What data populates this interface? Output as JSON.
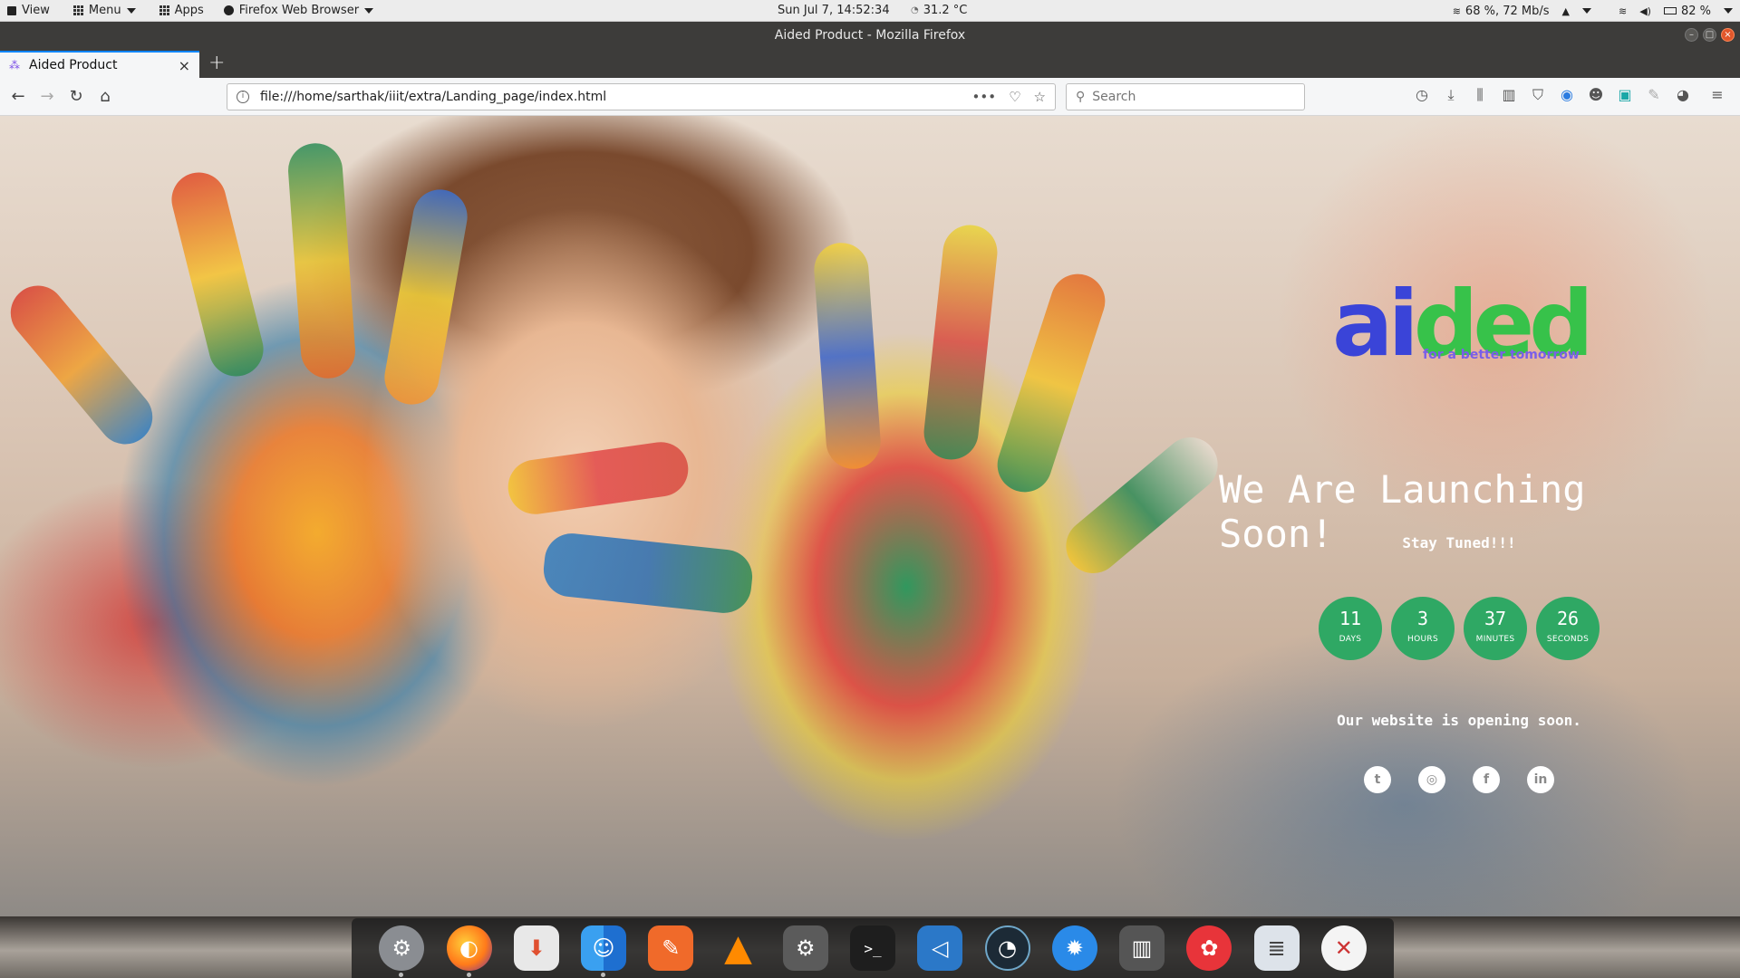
{
  "top_panel": {
    "view_label": "View",
    "menu_label": "Menu",
    "apps_label": "Apps",
    "browser_label": "Firefox Web Browser",
    "clock": "Sun Jul 7, 14:52:34",
    "temperature": "31.2 °C",
    "network": "68 %, 72 Mb/s",
    "battery": "82 %"
  },
  "window": {
    "title": "Aided Product - Mozilla Firefox"
  },
  "tab": {
    "label": "Aided Product"
  },
  "navbar": {
    "url": "file:///home/sarthak/iiit/extra/Landing_page/index.html",
    "search_placeholder": "Search"
  },
  "page": {
    "logo": {
      "part1": "ai",
      "part2": "ded",
      "tagline": "for a better tomorrow"
    },
    "headline": "We Are Launching Soon!",
    "subhead": "Stay Tuned!!!",
    "countdown": [
      {
        "value": "11",
        "label": "DAYS"
      },
      {
        "value": "3",
        "label": "HOURS"
      },
      {
        "value": "37",
        "label": "MINUTES"
      },
      {
        "value": "26",
        "label": "SECONDS"
      }
    ],
    "opening_text": "Our website is opening soon.",
    "social": {
      "twitter": "twitter-icon",
      "instagram": "instagram-icon",
      "facebook": "facebook-icon",
      "linkedin": "linkedin-icon"
    }
  },
  "colors": {
    "accent_green": "#2fa864",
    "logo_blue": "#3a44d8",
    "logo_green": "#37c24a",
    "tagline_purple": "#7a5ee8"
  }
}
